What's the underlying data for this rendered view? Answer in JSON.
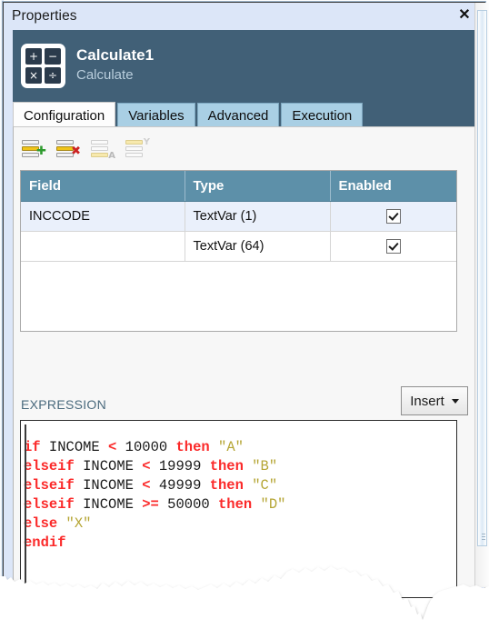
{
  "window": {
    "title": "Properties",
    "close_icon": "close-icon"
  },
  "header": {
    "icon": "calculator-icon",
    "icon_glyphs": [
      "+",
      "−",
      "×",
      "÷"
    ],
    "title": "Calculate1",
    "subtitle": "Calculate"
  },
  "tabs": [
    {
      "label": "Configuration",
      "active": true
    },
    {
      "label": "Variables",
      "active": false
    },
    {
      "label": "Advanced",
      "active": false
    },
    {
      "label": "Execution",
      "active": false
    }
  ],
  "toolbar": [
    {
      "name": "add-row-button",
      "icon": "rows-plus-icon",
      "enabled": true
    },
    {
      "name": "delete-row-button",
      "icon": "rows-delete-icon",
      "enabled": true
    },
    {
      "name": "sort-ascending-button",
      "icon": "rows-sort-a-icon",
      "enabled": false
    },
    {
      "name": "filter-button",
      "icon": "rows-filter-y-icon",
      "enabled": false
    }
  ],
  "grid": {
    "columns": [
      "Field",
      "Type",
      "Enabled"
    ],
    "rows": [
      {
        "field": "INCCODE",
        "type": "TextVar (1)",
        "enabled": true,
        "selected": true
      },
      {
        "field": "",
        "type": "TextVar (64)",
        "enabled": true,
        "selected": false
      }
    ]
  },
  "expression": {
    "label": "EXPRESSION",
    "insert_button": "Insert",
    "lines": [
      [
        {
          "t": "if",
          "c": "kw"
        },
        {
          "t": " "
        },
        {
          "t": "INCOME",
          "c": "id"
        },
        {
          "t": " "
        },
        {
          "t": "<",
          "c": "op"
        },
        {
          "t": " "
        },
        {
          "t": "10000",
          "c": "num"
        },
        {
          "t": " "
        },
        {
          "t": "then",
          "c": "kw"
        },
        {
          "t": " "
        },
        {
          "t": "\"A\"",
          "c": "str"
        }
      ],
      [
        {
          "t": "elseif",
          "c": "kw"
        },
        {
          "t": " "
        },
        {
          "t": "INCOME",
          "c": "id"
        },
        {
          "t": " "
        },
        {
          "t": "<",
          "c": "op"
        },
        {
          "t": " "
        },
        {
          "t": "19999",
          "c": "num"
        },
        {
          "t": " "
        },
        {
          "t": "then",
          "c": "kw"
        },
        {
          "t": " "
        },
        {
          "t": "\"B\"",
          "c": "str"
        }
      ],
      [
        {
          "t": "elseif",
          "c": "kw"
        },
        {
          "t": " "
        },
        {
          "t": "INCOME",
          "c": "id"
        },
        {
          "t": " "
        },
        {
          "t": "<",
          "c": "op"
        },
        {
          "t": " "
        },
        {
          "t": "49999",
          "c": "num"
        },
        {
          "t": " "
        },
        {
          "t": "then",
          "c": "kw"
        },
        {
          "t": " "
        },
        {
          "t": "\"C\"",
          "c": "str"
        }
      ],
      [
        {
          "t": "elseif",
          "c": "kw"
        },
        {
          "t": " "
        },
        {
          "t": "INCOME",
          "c": "id"
        },
        {
          "t": " "
        },
        {
          "t": ">=",
          "c": "op"
        },
        {
          "t": " "
        },
        {
          "t": "50000",
          "c": "num"
        },
        {
          "t": " "
        },
        {
          "t": "then",
          "c": "kw"
        },
        {
          "t": " "
        },
        {
          "t": "\"D\"",
          "c": "str"
        }
      ],
      [
        {
          "t": "else",
          "c": "kw"
        },
        {
          "t": " "
        },
        {
          "t": "\"X\"",
          "c": "str"
        }
      ],
      [
        {
          "t": "endif",
          "c": "kw"
        }
      ]
    ],
    "plain_text": "if INCOME < 10000 then \"A\"\nelseif INCOME < 19999 then \"B\"\nelseif INCOME < 49999 then \"C\"\nelseif INCOME >= 50000 then \"D\"\nelse \"X\"\nendif"
  },
  "colors": {
    "titlebar": "#dce6f8",
    "header_dark": "#416077",
    "tab_inactive": "#a9cfe4",
    "tab_active": "#fdfdfd",
    "grid_header": "#5d90a9",
    "row_selected": "#eaf0fb",
    "keyword": "#fb2a2a",
    "string": "#b5a534",
    "identifier": "#1a1a1a"
  }
}
